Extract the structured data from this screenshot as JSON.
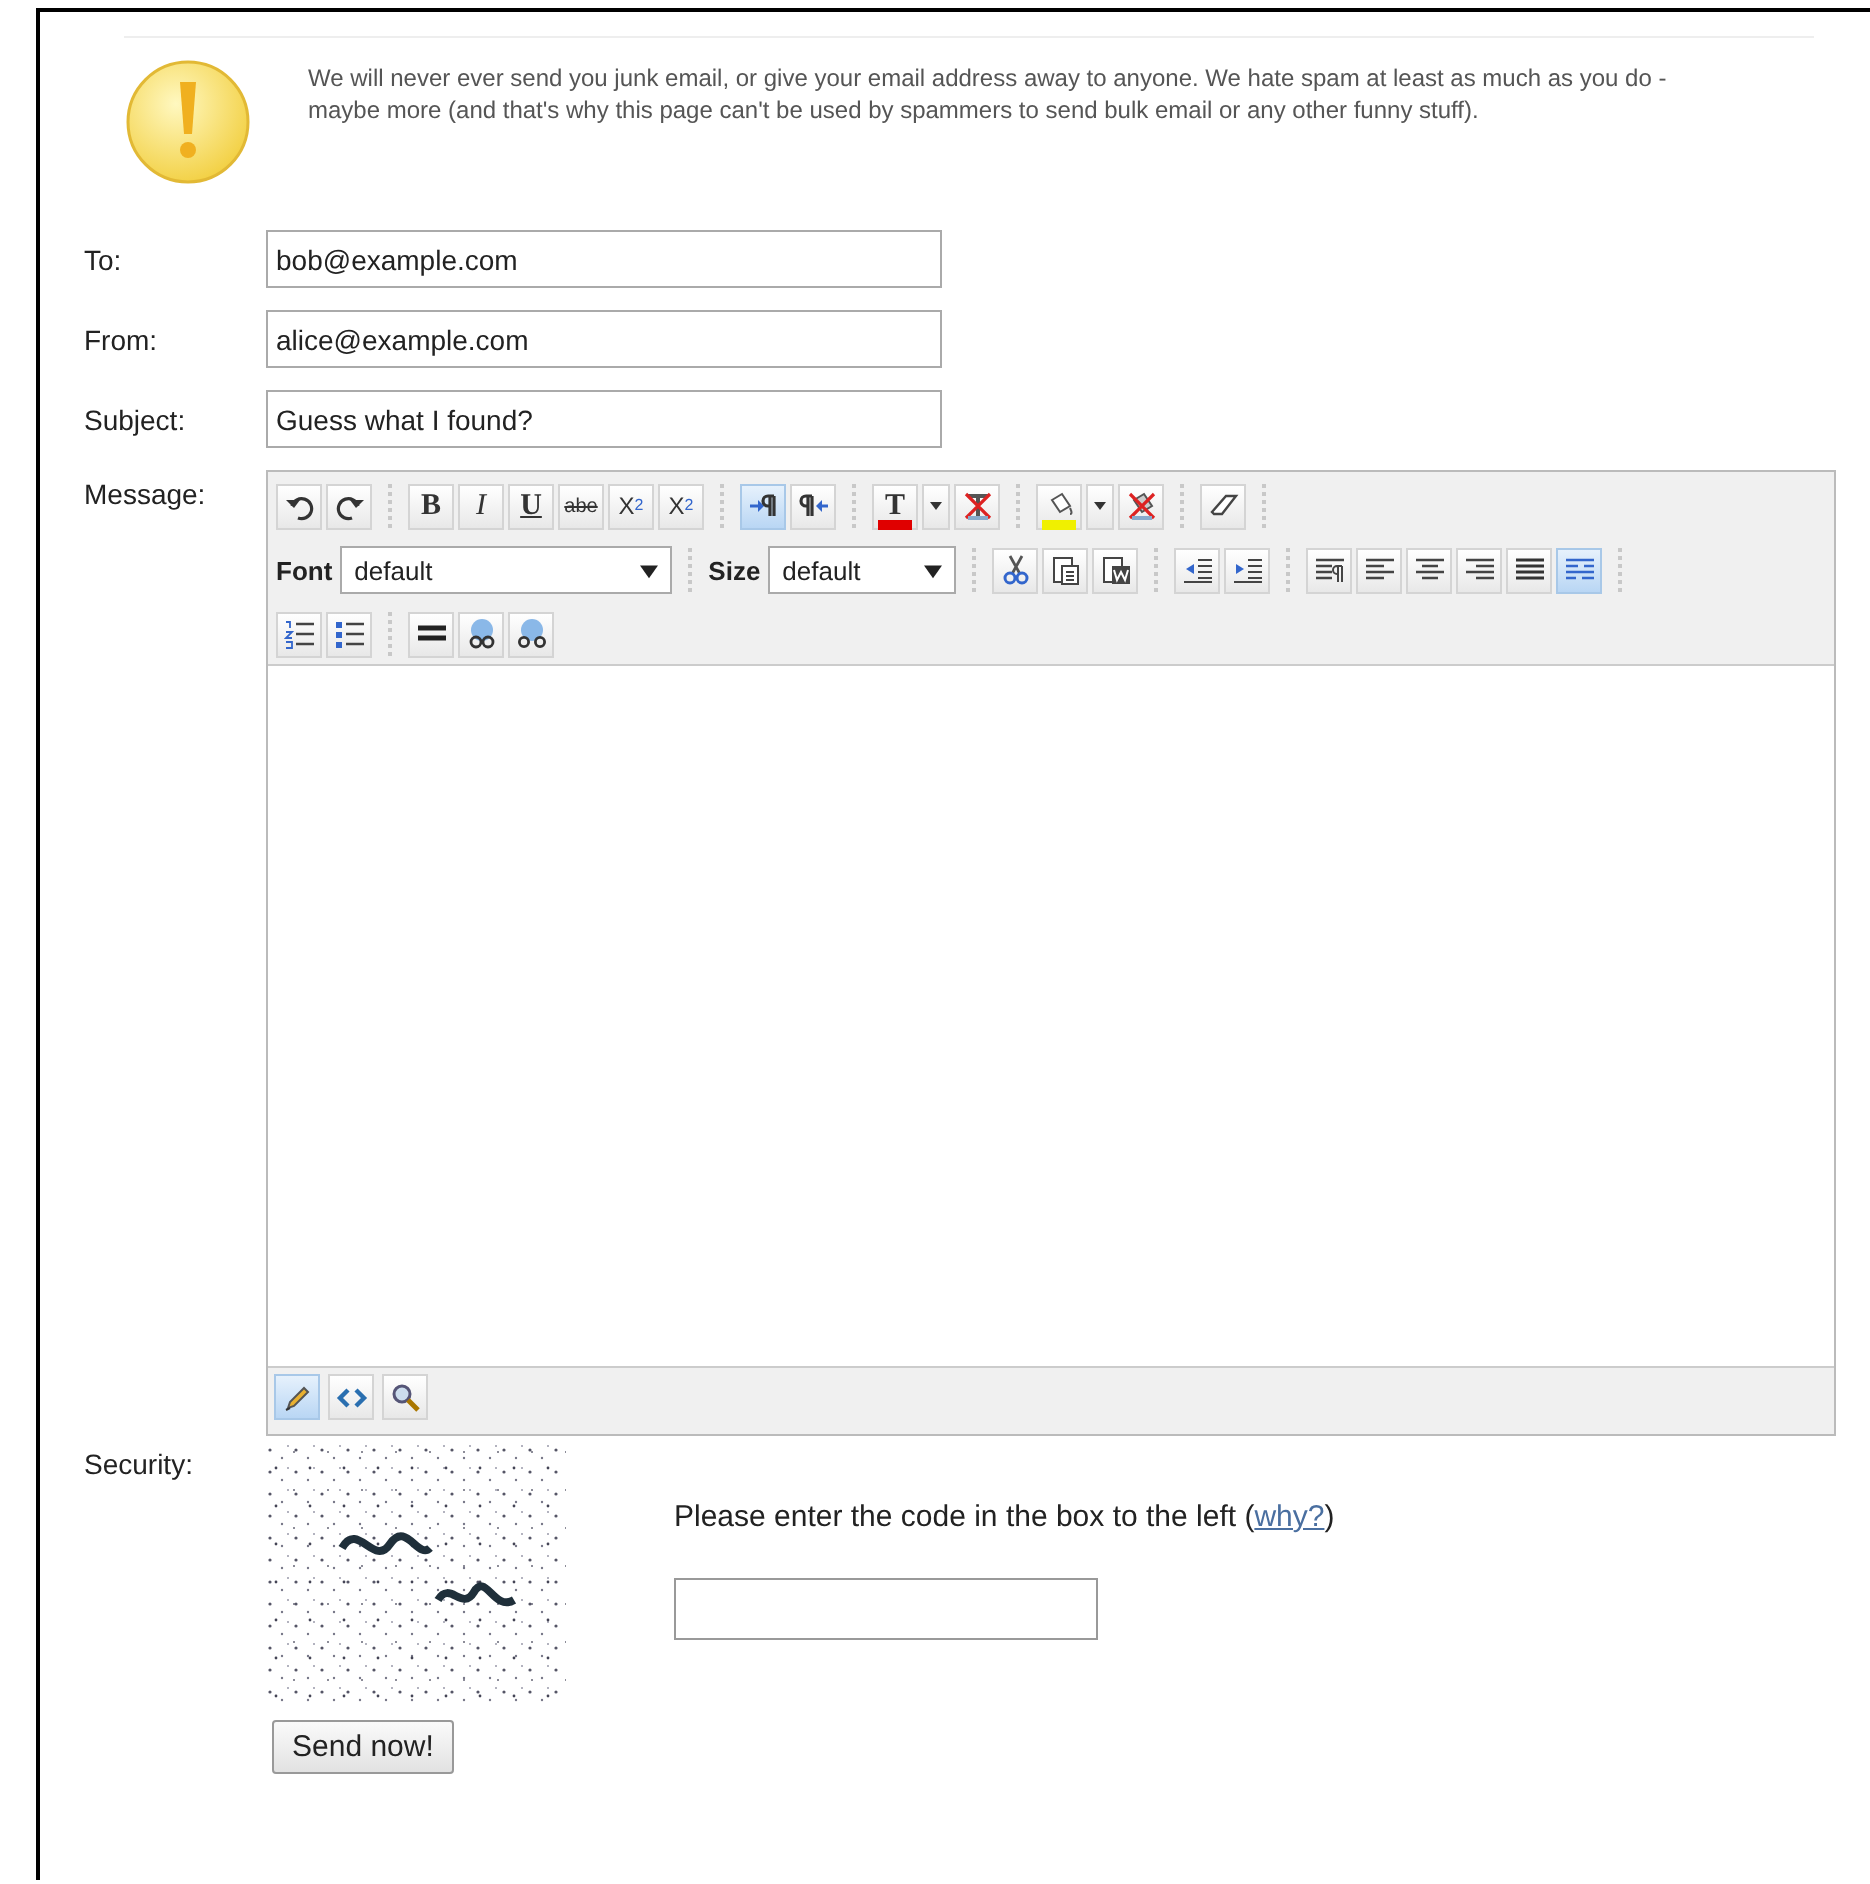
{
  "notice": {
    "text": "We will never ever send you junk email, or give your email address away to anyone. We hate spam at least as much as you do - maybe more (and that's why this page can't be used by spammers to send bulk email or any other funny stuff)."
  },
  "fields": [
    {
      "label": "To:",
      "value": "bob@example.com"
    },
    {
      "label": "From:",
      "value": "alice@example.com"
    },
    {
      "label": "Subject:",
      "value": "Guess what I found?"
    }
  ],
  "message": {
    "label": "Message:",
    "toolbar": [
      {
        "groups": [
          [
            {
              "kind": "undo",
              "selected": false
            },
            {
              "kind": "redo",
              "selected": false
            }
          ],
          [
            {
              "kind": "bold",
              "label": "B",
              "selected": false
            },
            {
              "kind": "italic",
              "label": "I",
              "selected": false
            },
            {
              "kind": "underline",
              "label": "U",
              "selected": false
            },
            {
              "kind": "strike",
              "label": "abe",
              "selected": false
            },
            {
              "kind": "subscript",
              "label": "X",
              "index": "2",
              "selected": false
            },
            {
              "kind": "superscript",
              "label": "X",
              "index": "2",
              "selected": false
            }
          ],
          [
            {
              "kind": "ltr",
              "selected": true
            },
            {
              "kind": "rtl",
              "selected": false
            }
          ],
          [
            {
              "kind": "forecolor",
              "label": "T",
              "color": "#e00000",
              "selected": false
            },
            {
              "kind": "menu",
              "selected": false
            },
            {
              "kind": "removeforecolor",
              "selected": false
            }
          ],
          [
            {
              "kind": "backcolor",
              "color": "#f0f000",
              "selected": false
            },
            {
              "kind": "menu",
              "selected": false
            },
            {
              "kind": "removebackcolor",
              "selected": false
            }
          ],
          [
            {
              "kind": "eraser",
              "selected": false
            }
          ]
        ]
      },
      {
        "groups": [
          [
            {
              "kind": "select",
              "label": "Font",
              "value": "default"
            }
          ],
          [
            {
              "kind": "select",
              "label": "Size",
              "value": "default"
            }
          ],
          [
            {
              "kind": "cut",
              "selected": false
            },
            {
              "kind": "paste",
              "selected": false
            },
            {
              "kind": "pasteword",
              "selected": false
            }
          ],
          [
            {
              "kind": "outdent",
              "selected": false
            },
            {
              "kind": "indent",
              "selected": false
            }
          ],
          [
            {
              "kind": "alignpara",
              "selected": false
            },
            {
              "kind": "alignleft",
              "selected": false
            },
            {
              "kind": "aligncenter",
              "selected": false
            },
            {
              "kind": "alignright",
              "selected": false
            },
            {
              "kind": "justify",
              "selected": false
            },
            {
              "kind": "justifyfull",
              "selected": true
            }
          ]
        ]
      },
      {
        "groups": [
          [
            {
              "kind": "orderedlist",
              "selected": false
            },
            {
              "kind": "bulletlist",
              "selected": false
            }
          ],
          [
            {
              "kind": "rule",
              "selected": false
            },
            {
              "kind": "link",
              "selected": false
            },
            {
              "kind": "unlink",
              "selected": false
            }
          ]
        ]
      }
    ],
    "modes": [
      {
        "kind": "design",
        "selected": true
      },
      {
        "kind": "source",
        "selected": false
      },
      {
        "kind": "preview",
        "selected": false
      }
    ]
  },
  "security": {
    "label": "Security:",
    "instruction": "Please enter the code in the box to the left (",
    "link": "why?",
    "closing": ")"
  },
  "send_button": "Send now!"
}
